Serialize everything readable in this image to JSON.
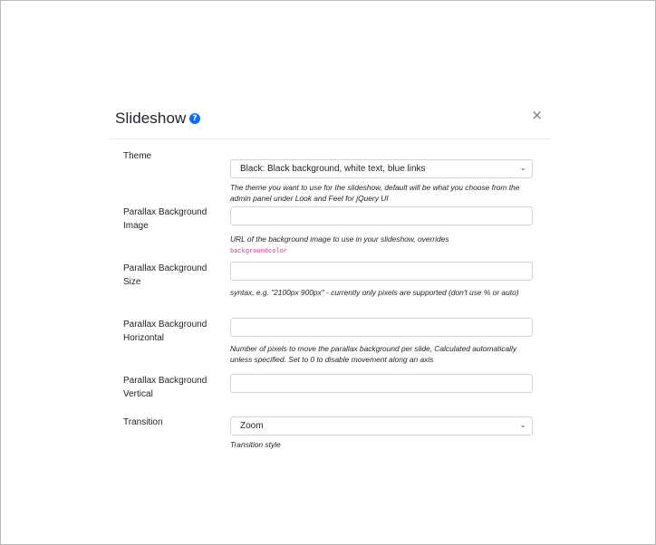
{
  "modal": {
    "title": "Slideshow",
    "close_symbol": "×",
    "help_symbol": "?"
  },
  "fields": [
    {
      "label": "Theme",
      "type": "select",
      "value": "Black: Black background, white text, blue links",
      "help": "The theme you want to use for the slideshow, default will be what you choose from the admin panel under Look and Feel for jQuery UI"
    },
    {
      "label": "Parallax Background Image",
      "type": "input",
      "value": "",
      "help": "URL of the background image to use in your slideshow, overrides",
      "help_code": "backgroundcolor"
    },
    {
      "label": "Parallax Background Size",
      "type": "input",
      "value": "",
      "help": "syntax, e.g. \"2100px 900px\" - currently only pixels are supported (don't use % or auto)"
    },
    {
      "label": "Parallax Background Horizontal",
      "type": "input",
      "value": "",
      "help": "Number of pixels to move the parallax background per slide, Calculated automatically unless specified. Set to 0 to disable movement along an axis"
    },
    {
      "label": "Parallax Background Vertical",
      "type": "input",
      "value": "",
      "help": ""
    },
    {
      "label": "Transition",
      "type": "select",
      "value": "Zoom",
      "help": "Transition style"
    }
  ],
  "icons": {
    "help": "question-circle-icon",
    "close": "close-icon",
    "chevron": "chevron-down-icon"
  },
  "colors": {
    "accent": "#0d6efd",
    "code": "#d63384"
  }
}
